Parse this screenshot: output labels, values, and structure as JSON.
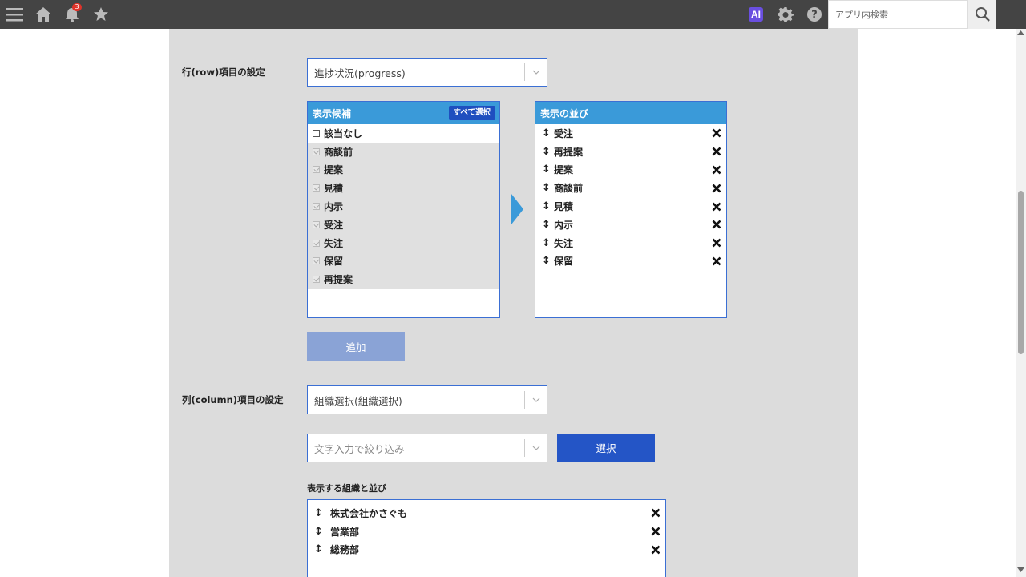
{
  "topbar": {
    "icons": [
      "menu-icon",
      "home-icon",
      "bell-icon",
      "star-icon",
      "ai-icon",
      "gear-icon",
      "help-icon",
      "search-icon"
    ],
    "notification_count": "3",
    "ai_label": "AI",
    "search_placeholder": "アプリ内検索"
  },
  "row_setting": {
    "label": "行(row)項目の設定",
    "selected": "進捗状況(progress)"
  },
  "candidates": {
    "title": "表示候補",
    "select_all": "すべて選択",
    "items": [
      {
        "label": "該当なし",
        "checked": false,
        "disabled": false
      },
      {
        "label": "商談前",
        "checked": true,
        "disabled": true
      },
      {
        "label": "提案",
        "checked": true,
        "disabled": true
      },
      {
        "label": "見積",
        "checked": true,
        "disabled": true
      },
      {
        "label": "内示",
        "checked": true,
        "disabled": true
      },
      {
        "label": "受注",
        "checked": true,
        "disabled": true
      },
      {
        "label": "失注",
        "checked": true,
        "disabled": true
      },
      {
        "label": "保留",
        "checked": true,
        "disabled": true
      },
      {
        "label": "再提案",
        "checked": true,
        "disabled": true
      }
    ]
  },
  "order": {
    "title": "表示の並び",
    "items": [
      "受注",
      "再提案",
      "提案",
      "商談前",
      "見積",
      "内示",
      "失注",
      "保留"
    ]
  },
  "add_button": "追加",
  "column_setting": {
    "label": "列(column)項目の設定",
    "selected": "組織選択(組織選択)"
  },
  "filter": {
    "placeholder": "文字入力で絞り込み"
  },
  "select_button": "選択",
  "org_section": {
    "title": "表示する組織と並び",
    "items": [
      "株式会社かさぐも",
      "営業部",
      "総務部"
    ]
  },
  "colors": {
    "topbar": "#444444",
    "panel": "#dcdcdc",
    "list_header": "#3a9ad9",
    "primary_button": "#2455c6",
    "disabled_button": "#8aa3d6",
    "ai_badge": "#6a4fe0",
    "notification_badge": "#e0332a"
  }
}
